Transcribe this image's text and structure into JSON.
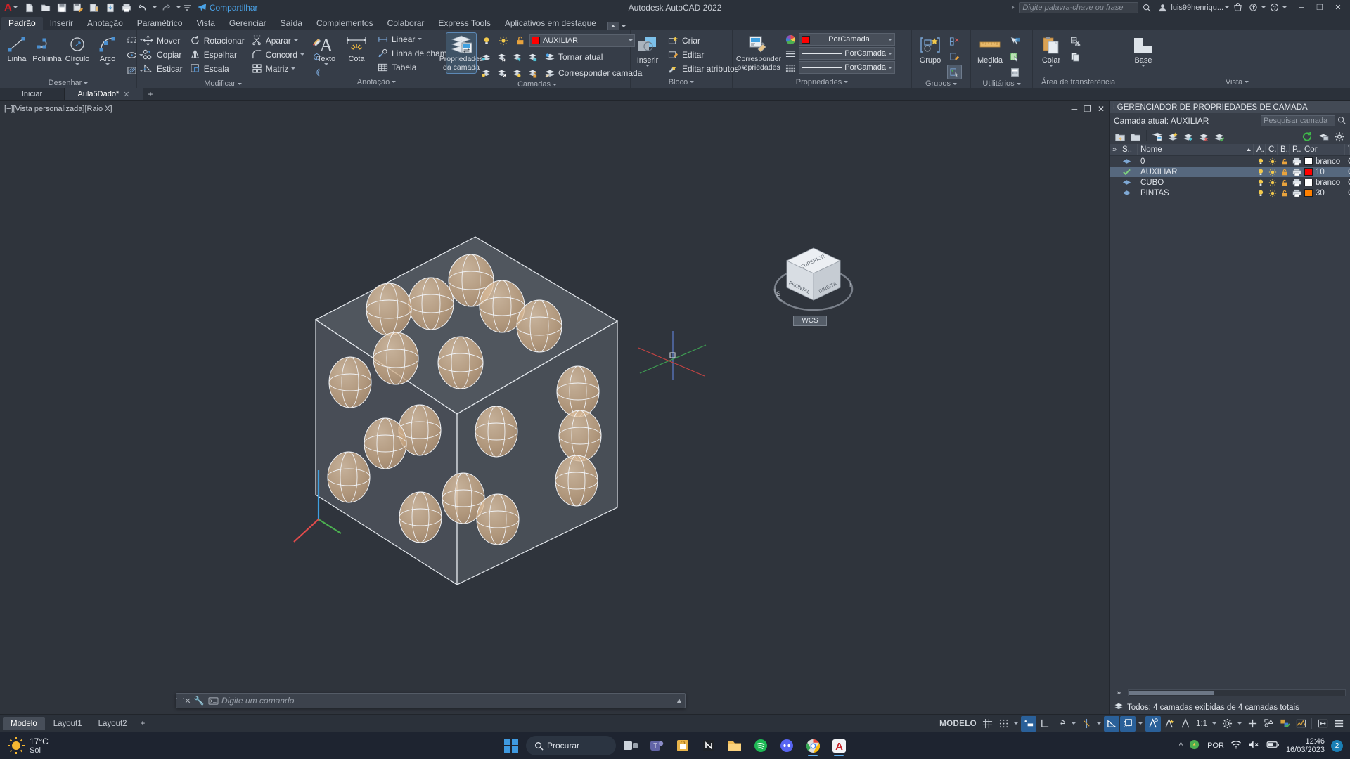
{
  "titlebar": {
    "app_title": "Autodesk AutoCAD 2022",
    "share_label": "Compartilhar",
    "search_placeholder": "Digite palavra-chave ou frase",
    "username": "luis99henriqu...",
    "qat": [
      "new-icon",
      "open-icon",
      "save-icon",
      "save-as-icon",
      "plot-icon",
      "cloud-sync-icon",
      "print-icon",
      "undo-icon",
      "redo-icon",
      "customize-icon"
    ]
  },
  "ribbon_tabs": [
    {
      "label": "Padrão",
      "active": true
    },
    {
      "label": "Inserir",
      "active": false
    },
    {
      "label": "Anotação",
      "active": false
    },
    {
      "label": "Paramétrico",
      "active": false
    },
    {
      "label": "Vista",
      "active": false
    },
    {
      "label": "Gerenciar",
      "active": false
    },
    {
      "label": "Saída",
      "active": false
    },
    {
      "label": "Complementos",
      "active": false
    },
    {
      "label": "Colaborar",
      "active": false
    },
    {
      "label": "Express Tools",
      "active": false
    },
    {
      "label": "Aplicativos em destaque",
      "active": false
    }
  ],
  "panels": {
    "desenhar": {
      "title": "Desenhar",
      "big": [
        {
          "label": "Linha",
          "icon": "line-icon"
        },
        {
          "label": "Polilinha",
          "icon": "polyline-icon"
        },
        {
          "label": "Círculo",
          "icon": "circle-icon",
          "dropdown": true
        },
        {
          "label": "Arco",
          "icon": "arc-icon",
          "dropdown": true
        }
      ],
      "small": [
        "rectangle-icon",
        "ellipse-icon",
        "hatch-icon"
      ]
    },
    "modificar": {
      "title": "Modificar",
      "col1": [
        {
          "label": "Mover",
          "icon": "move-icon"
        },
        {
          "label": "Copiar",
          "icon": "copy-icon"
        },
        {
          "label": "Esticar",
          "icon": "stretch-icon"
        }
      ],
      "col2": [
        {
          "label": "Rotacionar",
          "icon": "rotate-icon"
        },
        {
          "label": "Espelhar",
          "icon": "mirror-icon"
        },
        {
          "label": "Escala",
          "icon": "scale-icon"
        }
      ],
      "col3": [
        {
          "label": "Aparar",
          "icon": "trim-icon",
          "dropdown": true
        },
        {
          "label": "Concord",
          "icon": "fillet-icon",
          "dropdown": true
        },
        {
          "label": "Matriz",
          "icon": "array-icon",
          "dropdown": true
        }
      ],
      "col4": [
        "erase-icon",
        "explode-icon",
        "offset-icon"
      ]
    },
    "anotacao": {
      "title": "Anotação",
      "big": [
        {
          "label": "Texto",
          "icon": "text-icon",
          "dropdown": true
        },
        {
          "label": "Cota",
          "icon": "dimension-icon"
        }
      ],
      "items": [
        {
          "label": "Linear",
          "icon": "linear-dim-icon",
          "dropdown": true
        },
        {
          "label": "Linha de chamada",
          "icon": "leader-icon",
          "dropdown": true
        },
        {
          "label": "Tabela",
          "icon": "table-icon"
        }
      ]
    },
    "camadas": {
      "title": "Camadas",
      "big": {
        "label": "Propriedades da camada",
        "icon": "layer-properties-icon",
        "pressed": true
      },
      "layer_selector": {
        "name": "AUXILIAR",
        "color": "#fe0000",
        "icons": [
          "lightbulb-icon",
          "sun-icon",
          "unlock-icon"
        ]
      },
      "items": [
        {
          "label": "Tornar atual",
          "icon": "make-current-icon"
        },
        {
          "label": "Corresponder camada",
          "icon": "match-layer-icon"
        }
      ],
      "grid_icons": [
        "layer-isolate-icon",
        "layer-off-icon",
        "layer-freeze-icon",
        "layer-lock-icon",
        "layer-unisolate-icon",
        "layer-on-icon",
        "layer-thaw-icon",
        "layer-unlock-icon"
      ]
    },
    "bloco": {
      "title": "Bloco",
      "big": {
        "label": "Inserir",
        "icon": "insert-block-icon",
        "dropdown": true
      },
      "items": [
        {
          "label": "Criar",
          "icon": "create-block-icon"
        },
        {
          "label": "Editar",
          "icon": "edit-block-icon"
        },
        {
          "label": "Editar atributos",
          "icon": "edit-attributes-icon",
          "dropdown": true
        }
      ]
    },
    "propriedades": {
      "title": "Propriedades",
      "big": {
        "label": "Corresponder propriedades",
        "icon": "match-properties-icon"
      },
      "selects": [
        {
          "value": "PorCamada",
          "icon": "color-wheel-icon",
          "swatch": "#fe0000"
        },
        {
          "value": "PorCamada",
          "icon": "linetype-icon"
        },
        {
          "value": "PorCamada",
          "icon": "lineweight-icon"
        }
      ]
    },
    "grupos": {
      "title": "Grupos",
      "big": {
        "label": "Grupo",
        "icon": "group-icon"
      },
      "small": [
        "ungroup-icon",
        "group-edit-icon",
        "group-selection-icon"
      ]
    },
    "utilitarios": {
      "title": "Utilitários",
      "big": {
        "label": "Medida",
        "icon": "measure-icon",
        "dropdown": true
      },
      "small": [
        "quick-select-icon",
        "quick-calc-select-icon",
        "calculator-icon"
      ]
    },
    "transferencia": {
      "title": "Área de transferência",
      "big": {
        "label": "Colar",
        "icon": "paste-icon",
        "dropdown": true
      },
      "small": [
        "cut-icon",
        "copy-clip-icon"
      ]
    },
    "vista": {
      "title": "Vista",
      "big": {
        "label": "Base",
        "icon": "base-view-icon",
        "dropdown": true
      }
    }
  },
  "doctabs": [
    {
      "label": "Iniciar",
      "active": false,
      "closable": false
    },
    {
      "label": "Aula5Dado*",
      "active": true,
      "closable": true
    }
  ],
  "viewport": {
    "label": "[−][Vista personalizada][Raio X]",
    "viewcube_faces": [
      "SUPERIOR",
      "FRONTAL",
      "DIREITA"
    ],
    "wcs_label": "WCS",
    "ucs_axes": [
      "X",
      "Y",
      "Z"
    ]
  },
  "command": {
    "placeholder": "Digite um comando"
  },
  "layer_palette": {
    "title": "GERENCIADOR DE PROPRIEDADES DE CAMADA",
    "current_layer_label": "Camada atual: AUXILIAR",
    "search_placeholder": "Pesquisar camada",
    "toolbar_icons": [
      "new-layer-icon",
      "new-layer-vp-icon",
      "delete-layer-icon",
      "set-current-icon",
      "new-property-filter-icon",
      "new-group-filter-icon",
      "layer-states-icon"
    ],
    "right_icons": [
      "refresh-icon",
      "layer-state-manager-icon",
      "settings-icon"
    ],
    "columns": [
      "S..",
      "Nome",
      "A.",
      "C.",
      "B..",
      "P..",
      "Cor",
      "Tipo d"
    ],
    "rows": [
      {
        "status": "layer-icon",
        "name": "0",
        "on": "lightbulb-icon",
        "freeze": "sun-icon",
        "lock": "unlock-icon",
        "plot": "printer-icon",
        "color_name": "branco",
        "color_hex": "#ffffff",
        "linetype": "Contín",
        "selected": false
      },
      {
        "status": "current-check-icon",
        "name": "AUXILIAR",
        "on": "lightbulb-icon",
        "freeze": "sun-icon",
        "lock": "unlock-icon",
        "plot": "printer-icon",
        "color_name": "10",
        "color_hex": "#fe0000",
        "linetype": "Contí",
        "selected": true
      },
      {
        "status": "layer-icon",
        "name": "CUBO",
        "on": "lightbulb-icon",
        "freeze": "sun-icon",
        "lock": "unlock-icon",
        "plot": "printer-icon",
        "color_name": "branco",
        "color_hex": "#ffffff",
        "linetype": "Contí",
        "selected": false
      },
      {
        "status": "layer-icon",
        "name": "PINTAS",
        "on": "lightbulb-icon",
        "freeze": "sun-icon",
        "lock": "unlock-icon",
        "plot": "printer-icon",
        "color_name": "30",
        "color_hex": "#ff8000",
        "linetype": "Contí",
        "selected": false
      }
    ],
    "status_text": "Todos: 4 camadas exibidas de 4 camadas totais"
  },
  "statusbar": {
    "layout_tabs": [
      {
        "label": "Modelo",
        "active": true
      },
      {
        "label": "Layout1",
        "active": false
      },
      {
        "label": "Layout2",
        "active": false
      }
    ],
    "model_label": "MODELO",
    "scale": "1:1",
    "toggles": [
      {
        "name": "grid-display-toggle",
        "on": false
      },
      {
        "name": "snap-mode-toggle",
        "on": false
      },
      {
        "name": "dynamic-ucs-toggle",
        "on": true
      },
      {
        "name": "ortho-mode-toggle",
        "on": false
      },
      {
        "name": "polar-tracking-toggle",
        "on": false
      },
      {
        "name": "isometric-drafting-toggle",
        "on": false
      },
      {
        "name": "object-snap-toggle",
        "on": true
      },
      {
        "name": "3d-object-snap-toggle",
        "on": true
      },
      {
        "name": "object-snap-tracking-toggle",
        "on": true
      },
      {
        "name": "annotation-visibility-toggle",
        "on": false
      },
      {
        "name": "selection-cycling-toggle",
        "on": false
      }
    ]
  },
  "taskbar": {
    "weather_temp": "17°C",
    "weather_desc": "Sol",
    "search_label": "Procurar",
    "apps": [
      "start-icon",
      "task-view-icon",
      "teams-icon",
      "store-icon",
      "notion-icon",
      "file-explorer-icon",
      "spotify-icon",
      "discord-icon",
      "chrome-icon",
      "autocad-icon"
    ],
    "tray": {
      "language": "POR",
      "time": "12:46",
      "date": "16/03/2023",
      "notification_count": "2"
    }
  }
}
